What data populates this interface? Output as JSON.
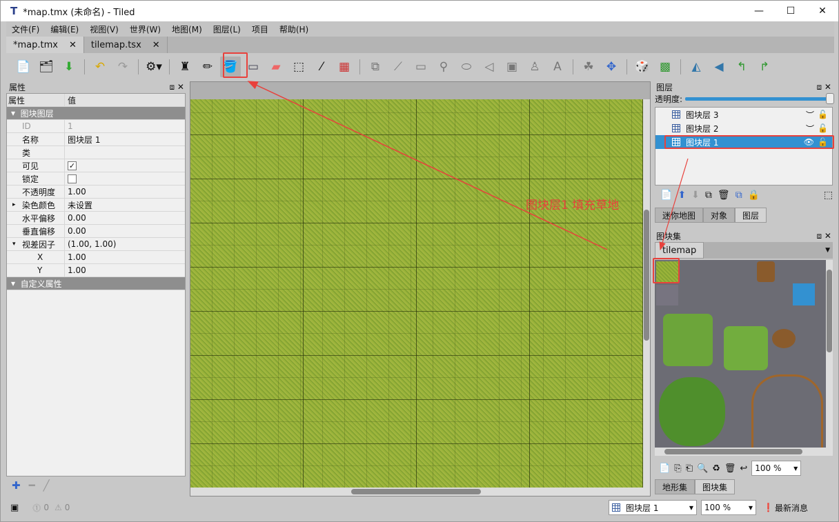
{
  "window": {
    "title": "*map.tmx (未命名) - Tiled",
    "minimize": "—",
    "maximize": "☐",
    "close": "✕"
  },
  "menu": [
    "文件(F)",
    "编辑(E)",
    "视图(V)",
    "世界(W)",
    "地图(M)",
    "图层(L)",
    "项目",
    "帮助(H)"
  ],
  "tabs": [
    {
      "label": "*map.tmx",
      "close": "✕"
    },
    {
      "label": "tilemap.tsx",
      "close": "✕"
    }
  ],
  "toolbar": {
    "icons": [
      "new-map",
      "open",
      "save",
      "undo",
      "redo",
      "commands",
      "stamp-brush",
      "terrain-brush",
      "bucket-fill",
      "shape-fill",
      "eraser",
      "rect-select",
      "magic-wand",
      "select-same-tile",
      "select-objects",
      "edit-polygons",
      "insert-rectangle",
      "insert-point",
      "insert-ellipse",
      "insert-polygon",
      "insert-tile",
      "insert-template",
      "insert-text",
      "random-mode",
      "move",
      "wang-dice",
      "tileset-map",
      "flip-h",
      "flip-v",
      "rotate-left",
      "rotate-right"
    ]
  },
  "properties": {
    "title": "属性",
    "col_key": "属性",
    "col_value": "值",
    "group": "图块图层",
    "rows": [
      {
        "k": "ID",
        "v": "1"
      },
      {
        "k": "名称",
        "v": "图块层 1"
      },
      {
        "k": "类",
        "v": ""
      },
      {
        "k": "可见",
        "v": "✓"
      },
      {
        "k": "锁定",
        "v": ""
      },
      {
        "k": "不透明度",
        "v": "1.00"
      },
      {
        "k": "染色颜色",
        "v": "未设置"
      },
      {
        "k": "水平偏移",
        "v": "0.00"
      },
      {
        "k": "垂直偏移",
        "v": "0.00"
      },
      {
        "k": "视差因子",
        "v": "(1.00, 1.00)"
      },
      {
        "k": "X",
        "v": "1.00"
      },
      {
        "k": "Y",
        "v": "1.00"
      }
    ],
    "custom": "自定义属性"
  },
  "layers": {
    "title": "图层",
    "opacity_label": "透明度:",
    "opacity": 1.0,
    "items": [
      {
        "name": "图块层 3",
        "visible": false
      },
      {
        "name": "图块层 2",
        "visible": false
      },
      {
        "name": "图块层 1",
        "visible": true,
        "selected": true
      }
    ],
    "tabs": [
      "迷你地图",
      "对象",
      "图层"
    ]
  },
  "tilesets": {
    "title": "图块集",
    "tab": "tilemap",
    "zoom": "100 %",
    "bottom_tabs": [
      "地形集",
      "图块集"
    ]
  },
  "annotation": {
    "text": "图块层1 填充草地",
    "color": "#e8413c"
  },
  "status": {
    "errors": "0",
    "warnings": "0",
    "layer": "图块层 1",
    "zoom": "100 %",
    "news": "最新消息"
  },
  "colors": {
    "selection": "#3391d1",
    "accent": "#e8413c"
  }
}
